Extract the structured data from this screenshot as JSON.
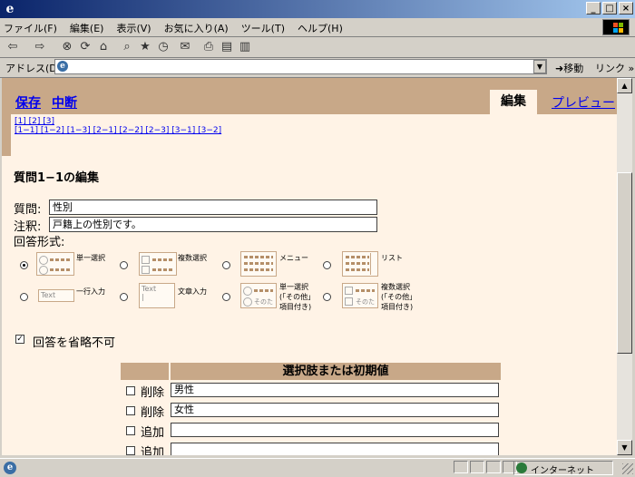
{
  "window": {
    "title": "",
    "buttons": [
      "_",
      "□",
      "×"
    ]
  },
  "menu": {
    "items": [
      "ファイル(F)",
      "編集(E)",
      "表示(V)",
      "お気に入り(A)",
      "ツール(T)",
      "ヘルプ(H)"
    ]
  },
  "toolbar": {
    "icons": [
      "back-icon",
      "forward-icon",
      "stop-icon",
      "refresh-icon",
      "home-icon",
      "search-icon",
      "favorites-icon",
      "history-icon",
      "mail-icon",
      "print-icon",
      "edit-icon",
      "discuss-icon"
    ],
    "glyphs": [
      "⇦",
      "⇨",
      "⊗",
      "⟳",
      "⌂",
      "⌕",
      "★",
      "◷",
      "✉",
      "⎙",
      "▤",
      "▥"
    ]
  },
  "address": {
    "label": "アドレス(D)",
    "value": "",
    "go_label": "移動",
    "links_label": "リンク »"
  },
  "page": {
    "save_link": "保存",
    "abort_link": "中断",
    "tab_edit": "編集",
    "tab_preview": "プレビュー",
    "nav_row1": "[1] [2] [3]",
    "nav_row2": "[1−1] [1−2] [1−3] [2−1] [2−2] [2−3] [3−1] [3−2]",
    "title": "質問1−1の編集",
    "question_label": "質問:",
    "question_value": "性別",
    "note_label": "注釈:",
    "note_value": "戸籍上の性別です。",
    "format_label": "回答形式:",
    "formats": {
      "single": "単一選択",
      "multi": "複数選択",
      "menu": "メニュー",
      "list": "リスト",
      "line": "一行入力",
      "text": "文章入力",
      "single_other_1": "単一選択",
      "single_other_2": "(「その他」",
      "single_other_3": "項目付き)",
      "multi_other_1": "複数選択",
      "multi_other_2": "(「その他」",
      "multi_other_3": "項目付き)"
    },
    "thumb_text": {
      "text": "Text",
      "other": "そのた"
    },
    "selected_format": "single",
    "required_label": "回答を省略不可",
    "required_checked": true,
    "options_header": "選択肢または初期値",
    "options": [
      {
        "label": "削除",
        "value": "男性"
      },
      {
        "label": "削除",
        "value": "女性"
      },
      {
        "label": "追加",
        "value": ""
      },
      {
        "label": "追加",
        "value": ""
      }
    ]
  },
  "status": {
    "zone": "インターネット"
  },
  "colors": {
    "band": "#c8a888",
    "content_bg": "#fff3e6",
    "link": "#0000ee"
  }
}
